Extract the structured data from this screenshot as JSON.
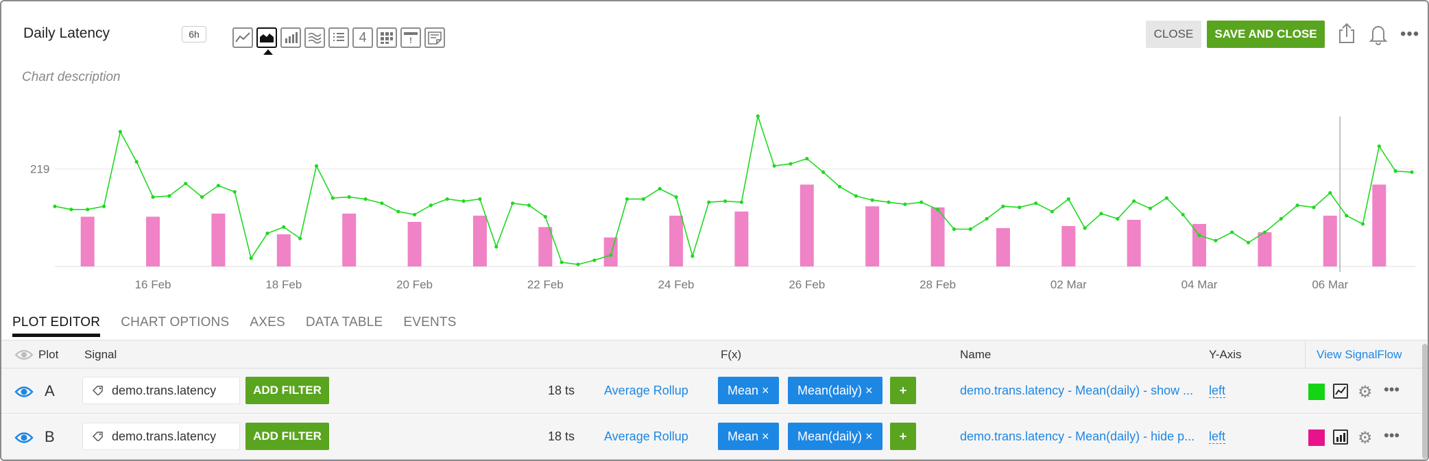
{
  "header": {
    "title": "Daily Latency",
    "time_range": "6h",
    "description_placeholder": "Chart description",
    "close_label": "CLOSE",
    "save_label": "SAVE AND CLOSE",
    "chart_type_icons": [
      "line-chart-icon",
      "area-chart-icon",
      "column-chart-icon",
      "histogram-icon",
      "list-icon",
      "single-value-icon",
      "heatmap-icon",
      "event-feed-icon",
      "text-note-icon"
    ],
    "single_value_glyph": "4",
    "event_glyph": "!"
  },
  "chart_data": {
    "type": "line",
    "y_tick_labels": [
      "219"
    ],
    "x_tick_labels": [
      "16 Feb",
      "18 Feb",
      "20 Feb",
      "22 Feb",
      "24 Feb",
      "26 Feb",
      "28 Feb",
      "02 Mar",
      "04 Mar",
      "06 Mar"
    ],
    "ylim": [
      125,
      275
    ],
    "series": [
      {
        "color": "#1fd91f",
        "style": "line",
        "x": [
          0,
          0.5,
          1,
          1.5,
          2,
          2.5,
          3,
          3.5,
          4,
          4.5,
          5,
          5.5,
          6,
          6.5,
          7,
          7.5,
          8,
          8.5,
          9,
          9.5,
          10,
          10.5,
          11,
          11.5,
          12,
          12.5,
          13,
          13.5,
          14,
          14.5,
          15,
          15.5,
          16,
          16.5,
          17,
          17.5,
          18,
          18.5,
          19,
          19.5,
          20,
          20.5,
          21,
          21.5,
          22,
          22.5,
          23,
          23.5,
          24,
          24.5,
          25,
          25.5,
          26,
          26.5,
          27,
          27.5,
          28,
          28.5,
          29,
          29.5,
          30,
          30.5,
          31,
          31.5,
          32,
          32.5,
          33,
          33.5,
          34,
          34.5,
          35,
          35.5,
          36,
          36.5,
          37,
          37.5,
          38,
          38.5,
          39,
          39.5,
          40,
          40.5,
          41,
          41.5
        ],
        "values": [
          183,
          180,
          180,
          183,
          255,
          226,
          192,
          193,
          205,
          192,
          203,
          197,
          133,
          157,
          163,
          152,
          222,
          191,
          192,
          190,
          186,
          178,
          175,
          184,
          190,
          188,
          190,
          144,
          186,
          184,
          173,
          129,
          127,
          131,
          136,
          190,
          190,
          200,
          192,
          135,
          187,
          188,
          187,
          270,
          222,
          224,
          229,
          216,
          202,
          193,
          189,
          187,
          185,
          187,
          180,
          161,
          161,
          171,
          183,
          182,
          186,
          178,
          190,
          162,
          176,
          171,
          188,
          181,
          191,
          175,
          155,
          150,
          158,
          148,
          158,
          171,
          184,
          182,
          196,
          174,
          166,
          241,
          217,
          216
        ],
        "point_fill": "#1fd91f"
      },
      {
        "color": "#f082c6",
        "style": "bar",
        "x": [
          1,
          3,
          5,
          7,
          9,
          11,
          13,
          15,
          17,
          19,
          21,
          23,
          25,
          27,
          29,
          31,
          33,
          35,
          37,
          39,
          40.5
        ],
        "values": [
          173,
          173,
          176,
          156,
          176,
          168,
          174,
          163,
          153,
          174,
          178,
          204,
          183,
          182,
          162,
          164,
          170,
          166,
          158,
          174,
          204
        ]
      }
    ],
    "x_domain": [
      0,
      41.5
    ],
    "x_tick_positions": [
      3,
      7,
      11,
      15,
      19,
      23,
      27,
      31,
      35,
      39
    ],
    "cursor_x": 39.3
  },
  "tabs": [
    "PLOT EDITOR",
    "CHART OPTIONS",
    "AXES",
    "DATA TABLE",
    "EVENTS"
  ],
  "table": {
    "headers": {
      "plot": "Plot",
      "signal": "Signal",
      "fx": "F(x)",
      "name": "Name",
      "yaxis": "Y-Axis",
      "view_signalflow": "View SignalFlow"
    },
    "rows": [
      {
        "letter": "A",
        "signal": "demo.trans.latency",
        "add_filter": "ADD FILTER",
        "ts": "18 ts",
        "rollup": "Average Rollup",
        "fx1": "Mean ×",
        "fx2": "Mean(daily) ×",
        "fx_add": "+",
        "name": "demo.trans.latency - Mean(daily) - show ...",
        "yaxis": "left",
        "color": "#14d414"
      },
      {
        "letter": "B",
        "signal": "demo.trans.latency",
        "add_filter": "ADD FILTER",
        "ts": "18 ts",
        "rollup": "Average Rollup",
        "fx1": "Mean ×",
        "fx2": "Mean(daily) ×",
        "fx_add": "+",
        "name": "demo.trans.latency - Mean(daily) - hide p...",
        "yaxis": "left",
        "color": "#e8138a"
      }
    ]
  }
}
